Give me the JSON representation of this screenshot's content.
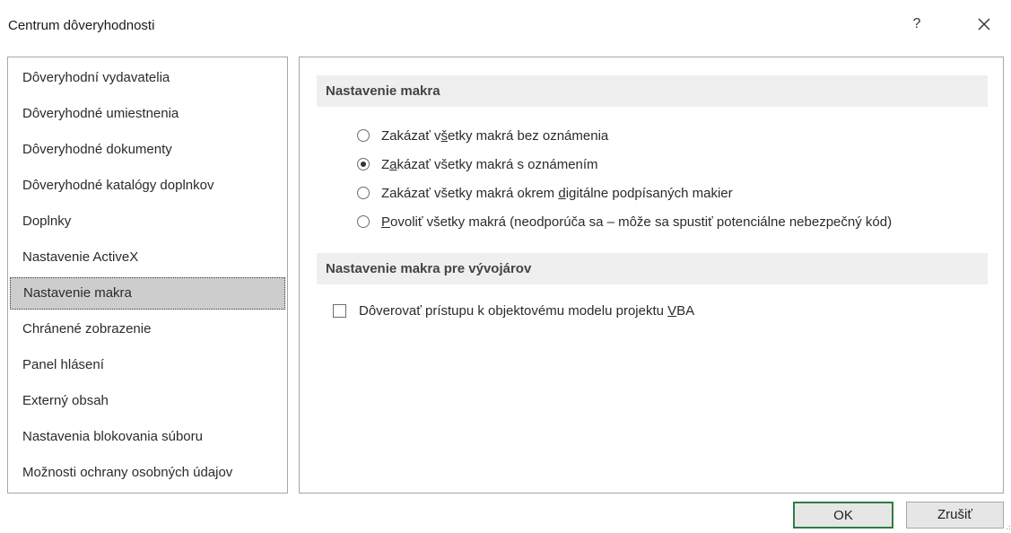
{
  "window": {
    "title": "Centrum dôveryhodnosti",
    "help_label": "?",
    "close_icon": "close-icon"
  },
  "sidebar": {
    "items": [
      {
        "label": "Dôveryhodní vydavatelia",
        "selected": false
      },
      {
        "label": "Dôveryhodné umiestnenia",
        "selected": false
      },
      {
        "label": "Dôveryhodné dokumenty",
        "selected": false
      },
      {
        "label": "Dôveryhodné katalógy doplnkov",
        "selected": false
      },
      {
        "label": "Doplnky",
        "selected": false
      },
      {
        "label": "Nastavenie ActiveX",
        "selected": false
      },
      {
        "label": "Nastavenie makra",
        "selected": true
      },
      {
        "label": "Chránené zobrazenie",
        "selected": false
      },
      {
        "label": "Panel hlásení",
        "selected": false
      },
      {
        "label": "Externý obsah",
        "selected": false
      },
      {
        "label": "Nastavenia blokovania súboru",
        "selected": false
      },
      {
        "label": "Možnosti ochrany osobných údajov",
        "selected": false
      }
    ]
  },
  "macro_settings": {
    "header": "Nastavenie makra",
    "options": [
      {
        "pre": "Zakázať v",
        "accel": "š",
        "post": "etky makrá bez oznámenia",
        "checked": false
      },
      {
        "pre": "Z",
        "accel": "a",
        "post": "kázať všetky makrá s oznámením",
        "checked": true
      },
      {
        "pre": "Zakázať všetky makrá okrem ",
        "accel": "d",
        "post": "igitálne podpísaných makier",
        "checked": false
      },
      {
        "pre": "",
        "accel": "P",
        "post": "ovoliť všetky makrá (neodporúča sa – môže sa spustiť potenciálne nebezpečný kód)",
        "checked": false
      }
    ]
  },
  "developer_settings": {
    "header": "Nastavenie makra pre vývojárov",
    "checkbox": {
      "pre": "Dôverovať prístupu k objektovému modelu projektu ",
      "accel": "V",
      "post": "BA",
      "checked": false
    }
  },
  "buttons": {
    "ok": "OK",
    "cancel": "Zrušiť"
  },
  "colors": {
    "ok_border": "#2f7d43",
    "selected_bg": "#cdcdcd",
    "section_bg": "#efefef"
  }
}
